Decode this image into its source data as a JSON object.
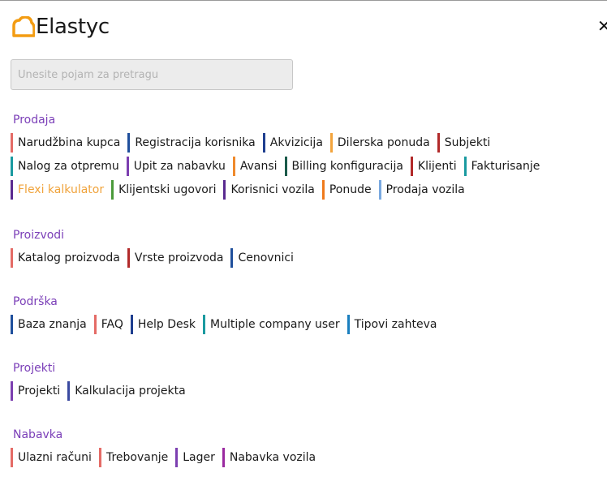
{
  "app": {
    "brand": "Elastyc",
    "brand_color": "#f39c12"
  },
  "search": {
    "placeholder": "Unesite pojam za pretragu"
  },
  "sections": [
    {
      "title": "Prodaja",
      "links": [
        {
          "label": "Narudžbina kupca",
          "color": "#e46b66"
        },
        {
          "label": "Registracija korisnika",
          "color": "#1f4f9c"
        },
        {
          "label": "Akvizicija",
          "color": "#1f3f8f"
        },
        {
          "label": "Dilerska ponuda",
          "color": "#f3a43c"
        },
        {
          "label": "Subjekti",
          "color": "#b22a2a"
        },
        {
          "label": "Nalog za otpremu",
          "color": "#1a9aa0"
        },
        {
          "label": "Upit za nabavku",
          "color": "#7c3fb0"
        },
        {
          "label": "Avansi",
          "color": "#ef8a2c"
        },
        {
          "label": "Billing konfiguracija",
          "color": "#1b5a4a"
        },
        {
          "label": "Klijenti",
          "color": "#b22a2a"
        },
        {
          "label": "Fakturisanje",
          "color": "#1a9aa0"
        },
        {
          "label": "Flexi kalkulator",
          "color": "#5a2a90",
          "highlight": true
        },
        {
          "label": "Klijentski ugovori",
          "color": "#4a9a3a"
        },
        {
          "label": "Korisnici vozila",
          "color": "#5a2a90"
        },
        {
          "label": "Ponude",
          "color": "#ef7a1c"
        },
        {
          "label": "Prodaja vozila",
          "color": "#79a9e0"
        }
      ]
    },
    {
      "title": "Proizvodi",
      "links": [
        {
          "label": "Katalog proizvoda",
          "color": "#e46b66"
        },
        {
          "label": "Vrste proizvoda",
          "color": "#b22a2a"
        },
        {
          "label": "Cenovnici",
          "color": "#1f4f9c"
        }
      ]
    },
    {
      "title": "Podrška",
      "links": [
        {
          "label": "Baza znanja",
          "color": "#1f4f9c"
        },
        {
          "label": "FAQ",
          "color": "#e46b66"
        },
        {
          "label": "Help Desk",
          "color": "#1f3f8f"
        },
        {
          "label": "Multiple company user",
          "color": "#1a9aa0"
        },
        {
          "label": "Tipovi zahteva",
          "color": "#1a7fbf"
        }
      ]
    },
    {
      "title": "Projekti",
      "links": [
        {
          "label": "Projekti",
          "color": "#7c3fb0"
        },
        {
          "label": "Kalkulacija projekta",
          "color": "#3a4aa0"
        }
      ]
    },
    {
      "title": "Nabavka",
      "links": [
        {
          "label": "Ulazni računi",
          "color": "#e46b66"
        },
        {
          "label": "Trebovanje",
          "color": "#e46b66"
        },
        {
          "label": "Lager",
          "color": "#7c3fb0"
        },
        {
          "label": "Nabavka vozila",
          "color": "#9a2aa0"
        }
      ]
    }
  ]
}
